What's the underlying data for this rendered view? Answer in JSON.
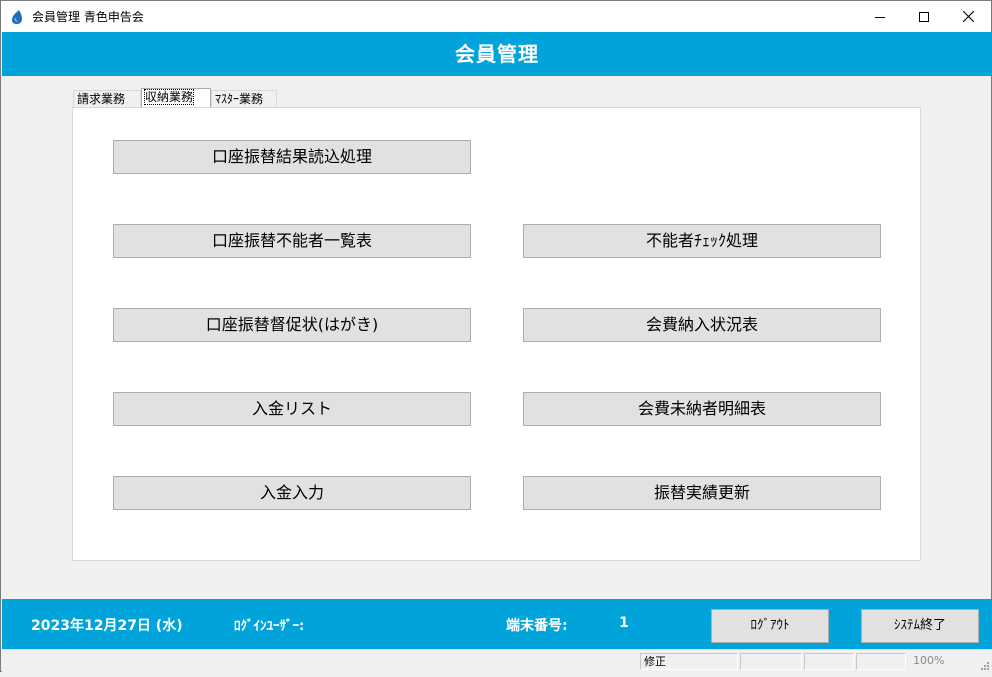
{
  "window": {
    "title": "会員管理 青色申告会",
    "icons": {
      "app": "droplet-icon",
      "minimize": "minimize-icon",
      "maximize": "maximize-icon",
      "close": "close-icon"
    }
  },
  "header": {
    "title": "会員管理",
    "color": "#00a4db"
  },
  "tabs": [
    {
      "label": "請求業務",
      "active": false
    },
    {
      "label": "収納業務",
      "active": true
    },
    {
      "label": "ﾏｽﾀｰ業務",
      "active": false
    }
  ],
  "buttons": {
    "left": [
      "口座振替結果読込処理",
      "口座振替不能者一覧表",
      "口座振替督促状(はがき)",
      "入金リスト",
      "入金入力"
    ],
    "right": [
      "不能者ﾁｪｯｸ処理",
      "会費納入状況表",
      "会費未納者明細表",
      "振替実績更新"
    ]
  },
  "footer": {
    "date": "2023年12月27日 (水)",
    "login_label": "ﾛｸﾞｲﾝﾕｰｻﾞｰ:",
    "terminal_label": "端末番号:",
    "terminal_value": "1",
    "logout_label": "ﾛｸﾞｱｳﾄ",
    "exit_label": "ｼｽﾃﾑ終了"
  },
  "statusbar": {
    "mode": "修正",
    "zoom": "100%"
  }
}
